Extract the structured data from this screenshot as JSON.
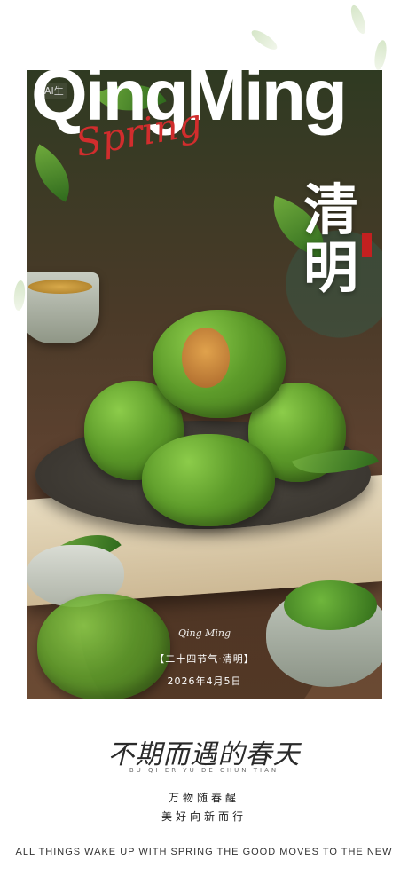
{
  "poster": {
    "ai_badge": "AI生",
    "brand_title": "QingMing",
    "brand_sub": "Spring",
    "vertical_title_line1": "清",
    "vertical_title_line2": "明",
    "script_small": "Qing Ming",
    "solar_term": "【二十四节气·清明】",
    "date": "2026年4月5日"
  },
  "bottom": {
    "calligraphy": "不期而遇的春天",
    "caption": "BU QI ER YU DE CHUN TIAN",
    "line1": "万物随春醒",
    "line2": "美好向新而行",
    "footer": "ALL THINGS WAKE UP WITH SPRING THE GOOD MOVES TO THE NEW"
  }
}
